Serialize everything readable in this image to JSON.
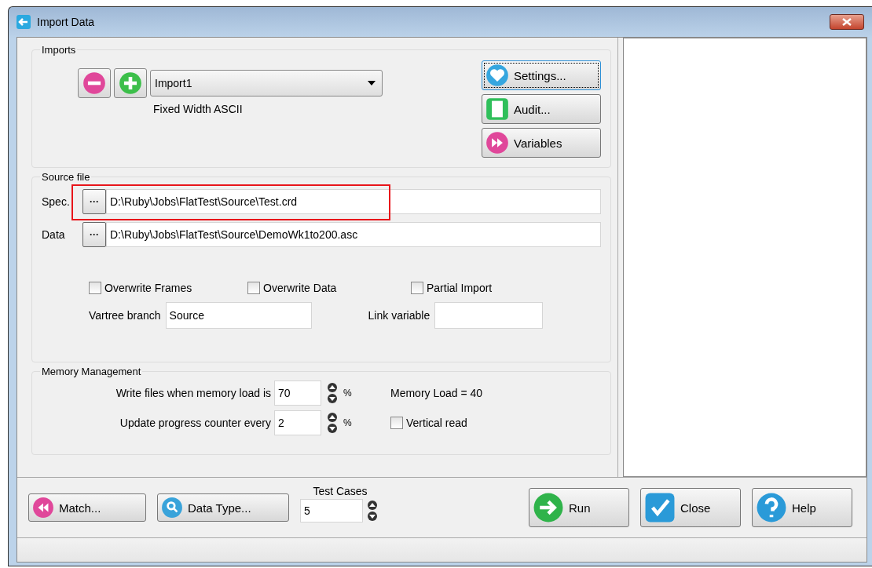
{
  "window": {
    "title": "Import Data"
  },
  "imports": {
    "label": "Imports",
    "dropdown": "Import1",
    "type_label": "Fixed Width ASCII",
    "icon_buttons": [
      {
        "kind": "minus"
      },
      {
        "kind": "plus"
      }
    ],
    "buttons": [
      {
        "label": "Settings...",
        "kind": "heart",
        "focused": true
      },
      {
        "label": "Audit...",
        "kind": "page",
        "focused": false
      },
      {
        "label": "Variables",
        "kind": "forward",
        "focused": false
      }
    ]
  },
  "source_file": {
    "label": "Source file",
    "files": [
      {
        "label": "Spec.",
        "browse": "···",
        "value": "D:\\Ruby\\Jobs\\FlatTest\\Source\\Test.crd",
        "highlighted": true
      },
      {
        "label": "Data",
        "browse": "···",
        "value": "D:\\Ruby\\Jobs\\FlatTest\\Source\\DemoWk1to200.asc",
        "highlighted": false
      }
    ],
    "checkboxes": [
      {
        "label": "Overwrite Frames",
        "checked": false
      },
      {
        "label": "Overwrite Data",
        "checked": false
      },
      {
        "label": "Partial Import",
        "checked": false
      }
    ],
    "vartree_branch": {
      "label": "Vartree branch",
      "value": "Source"
    },
    "link_variable": {
      "label": "Link variable"
    }
  },
  "memory": {
    "label": "Memory Management",
    "rows": [
      {
        "label": "Write files when memory load is",
        "value": "70",
        "unit": "%",
        "side": {
          "kind": "text",
          "label": "Memory Load = 40"
        }
      },
      {
        "label": "Update progress counter every",
        "value": "2",
        "unit": "%",
        "side": {
          "kind": "checkbox",
          "label": "Vertical read",
          "checked": false
        }
      }
    ]
  },
  "bottom": {
    "left_buttons": [
      {
        "label": "Match...",
        "kind": "rewind"
      },
      {
        "label": "Data Type...",
        "kind": "search"
      }
    ],
    "test_cases": {
      "label": "Test Cases",
      "value": "5"
    },
    "right_buttons": [
      {
        "label": "Run",
        "kind": "arrow"
      },
      {
        "label": "Close",
        "kind": "check"
      },
      {
        "label": "Help",
        "kind": "help"
      }
    ]
  }
}
